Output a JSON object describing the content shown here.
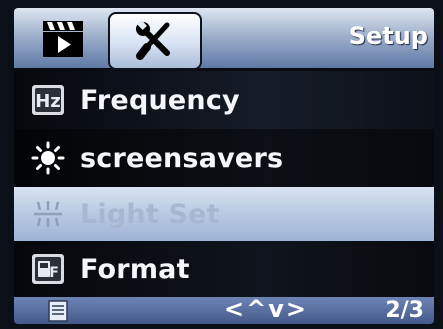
{
  "header": {
    "tabs": [
      {
        "icon": "movie-clapper-icon"
      },
      {
        "icon": "tools-icon",
        "selected": true
      }
    ],
    "title": "Setup"
  },
  "menu": {
    "items": [
      {
        "icon": "frequency-hz-icon",
        "label": "Frequency"
      },
      {
        "icon": "sun-icon",
        "label": "screensavers"
      },
      {
        "icon": "light-set-icon",
        "label": "Light Set",
        "selected": true
      },
      {
        "icon": "format-card-icon",
        "label": "Format"
      }
    ]
  },
  "footer": {
    "left_icon": "document-icon",
    "nav": "<^v>",
    "page": "2/3"
  },
  "colors": {
    "header_light": "#dfe6f1",
    "header_dark": "#5f7aa6",
    "highlight": "#b8c9e2",
    "footer": "#4f6699",
    "text": "#ffffff"
  }
}
